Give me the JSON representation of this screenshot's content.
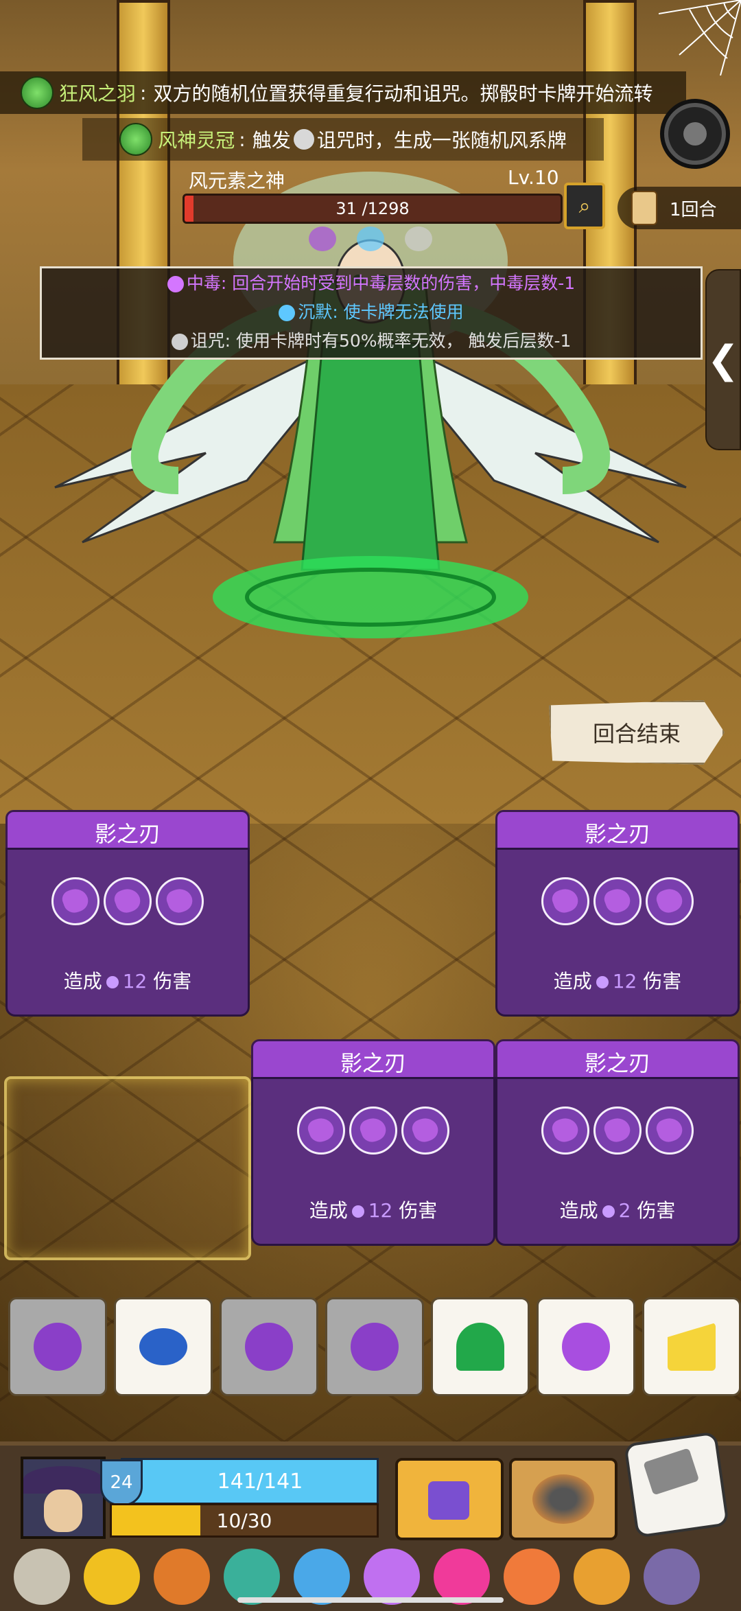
{
  "banners": {
    "relic1": {
      "name": "狂风之羽",
      "sep": ":",
      "text": "双方的随机位置获得重复行动和诅咒。掷骰时卡牌开始流转"
    },
    "relic2": {
      "name": "风神灵冠",
      "sep": ":",
      "text_before": "触发",
      "text_after": "诅咒时，生成一张随机风系牌"
    }
  },
  "boss": {
    "name": "风元素之神",
    "level": "Lv.10",
    "hp_text": "31 /1298",
    "hp_current": 31,
    "hp_max": 1298
  },
  "round": {
    "label": "1回合"
  },
  "tooltip": {
    "poison": {
      "key": "中毒",
      "text": ": 回合开始时受到中毒层数的伤害，中毒层数-1"
    },
    "silence": {
      "key": "沉默",
      "text": ": 使卡牌无法使用"
    },
    "curse": {
      "key": "诅咒",
      "text": ": 使用卡牌时有50%概率无效，  触发后层数-1"
    }
  },
  "side_tab": {
    "glyph": "❮"
  },
  "end_turn": {
    "label": "回合结束"
  },
  "cards": [
    {
      "title": "影之刃",
      "desc_before": "造成",
      "damage": "12",
      "desc_after": "伤害"
    },
    {
      "title": "影之刃",
      "desc_before": "造成",
      "damage": "12",
      "desc_after": "伤害"
    },
    {
      "title": "影之刃",
      "desc_before": "造成",
      "damage": "12",
      "desc_after": "伤害"
    },
    {
      "title": "影之刃",
      "desc_before": "造成",
      "damage": "2",
      "desc_after": "伤害"
    }
  ],
  "dice_row": [
    {
      "icon": "purple-crystal-icon",
      "state": "used"
    },
    {
      "icon": "blue-macaron-icon",
      "state": "ready"
    },
    {
      "icon": "purple-crystal-icon",
      "state": "used"
    },
    {
      "icon": "purple-crystal-icon",
      "state": "used"
    },
    {
      "icon": "green-icecream-icon",
      "state": "ready"
    },
    {
      "icon": "purple-crystal-icon",
      "state": "ready"
    },
    {
      "icon": "cheese-icon",
      "state": "ready"
    }
  ],
  "player": {
    "level": "24",
    "hp_text": "141/141",
    "energy_text": "10/30",
    "energy_current": 10,
    "energy_max": 30
  },
  "relics": [
    "scroll-icon",
    "crown-icon",
    "flame-icon",
    "amulet-icon",
    "potion-icon",
    "moon-orb-icon",
    "pink-flame-icon",
    "donut-icon",
    "spiky-die-icon",
    "crescent-icon"
  ],
  "colors": {
    "card_purple": "#5b2f7e",
    "card_header": "#9a47cf",
    "hp_red": "#e23b2c",
    "player_hp": "#58c8f5",
    "energy": "#f3c21e"
  }
}
